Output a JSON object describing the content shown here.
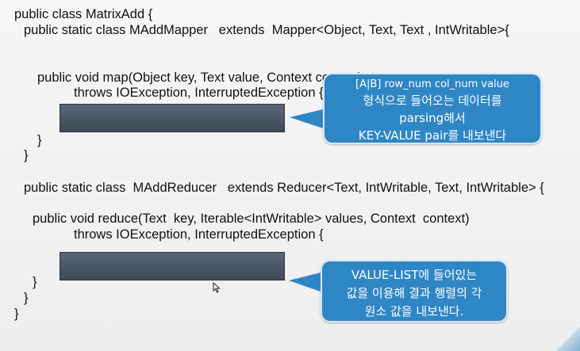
{
  "code": {
    "line1": "public class MatrixAdd {",
    "line2": "public static class MAddMapper   extends  Mapper<Object, Text, Text , IntWritable>{",
    "line3": "public void map(Object key, Text value, Context context)",
    "line4": "throws IOException, InterruptedException {",
    "line5": "}",
    "line6": "}",
    "line7": "public static class  MAddReducer   extends Reducer<Text, IntWritable, Text, IntWritable> {",
    "line8": "public void reduce(Text  key, Iterable<IntWritable> values, Context  context)",
    "line9": "throws IOException, InterruptedException {",
    "line10": "}",
    "line11": "}",
    "line12": "}"
  },
  "callouts": {
    "mapper": {
      "line1": "[A|B] row_num  col_num value",
      "line2": "형식으로 들어오는 데이터를",
      "line3": "parsing해서",
      "line4": "KEY-VALUE pair를 내보낸다"
    },
    "reducer": {
      "line1": "VALUE-LIST에 들어있는",
      "line2": "값을 이용해 결과 행렬의 각",
      "line3": "원소 값을 내보낸다."
    }
  },
  "colors": {
    "callout_fill": "#2f86c5",
    "redaction_bar": "#4a5665"
  }
}
